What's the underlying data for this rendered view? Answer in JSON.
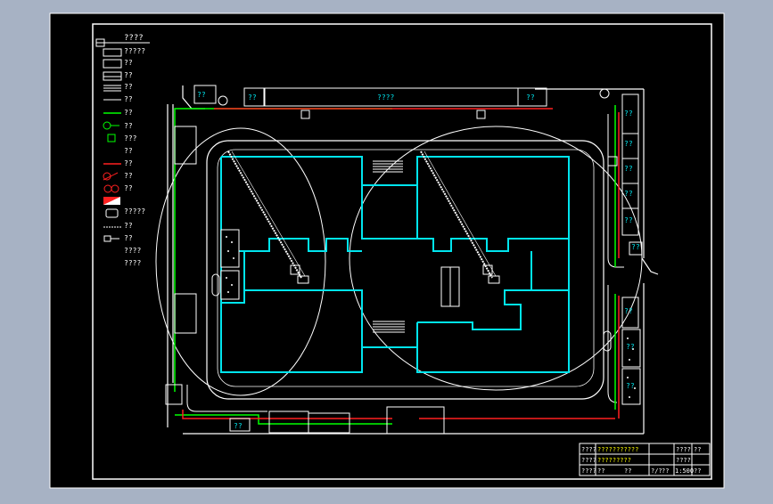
{
  "colors": {
    "window_bg": "#a7b2c4",
    "canvas_bg": "#000000",
    "frame": "#ffffff",
    "building": "#00e5ee",
    "fence": "#ffffff",
    "pipe_green": "#00ff00",
    "pipe_red": "#ff2020",
    "title_yellow": "#ffff00"
  },
  "legend": {
    "title": "????",
    "items": [
      "?????",
      "??",
      "??",
      "??",
      "??",
      "??",
      "??",
      "???",
      "??",
      "??",
      "??",
      "??",
      "?????",
      "??",
      "??",
      "????",
      "????"
    ]
  },
  "labels": {
    "top_building_center": "????",
    "top_building_left": "??",
    "top_building_right": "??",
    "top_gate_box": "??",
    "right_column": [
      "??",
      "??",
      "??",
      "??",
      "??",
      "??",
      "??",
      "??",
      "??"
    ],
    "bottom_box": "??",
    "top_right_box": "??"
  },
  "title_block": {
    "r1": [
      "????",
      "???????????",
      "????",
      "??"
    ],
    "r2": [
      "????",
      "?????????",
      "",
      "????"
    ],
    "r3": [
      "????",
      "??",
      "??",
      "?/?",
      "??",
      "1:500",
      "??"
    ]
  }
}
